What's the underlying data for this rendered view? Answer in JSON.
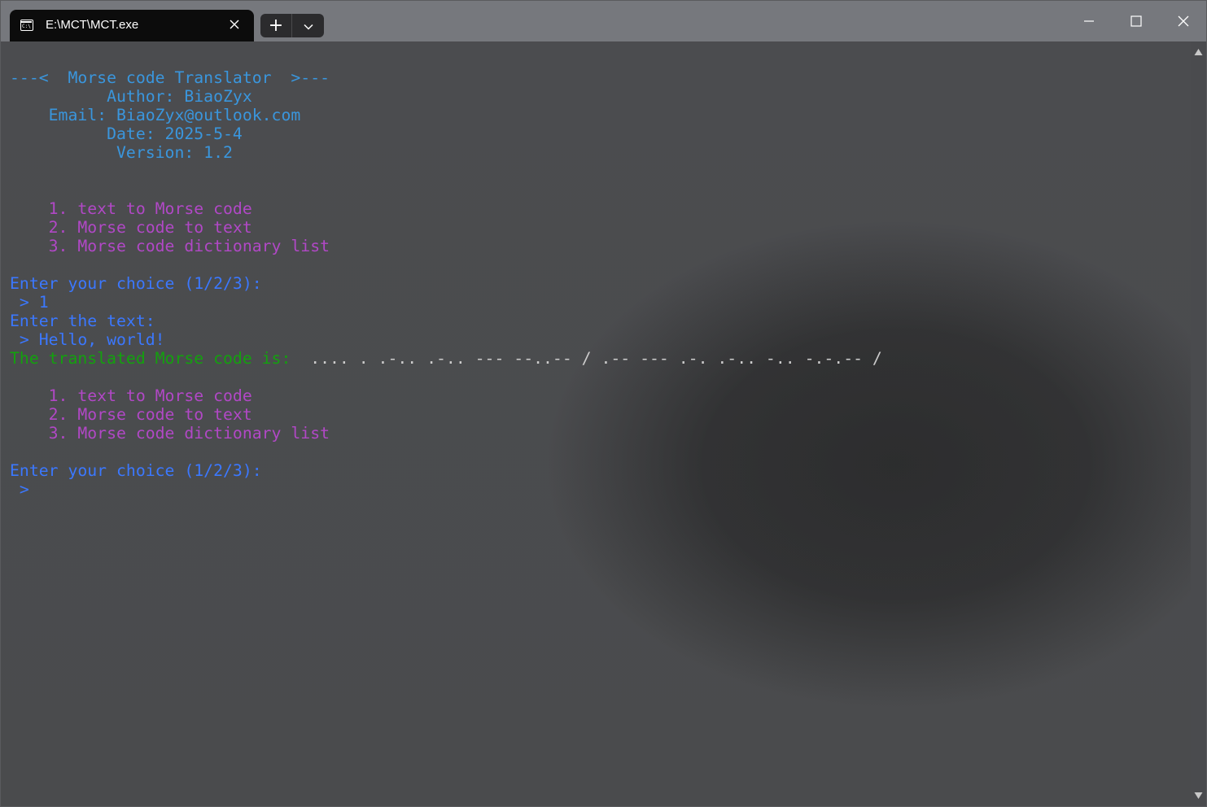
{
  "window": {
    "tab_title": "E:\\MCT\\MCT.exe",
    "tab_icon_text": "C:\\",
    "new_tab_label": "+",
    "colors": {
      "titlebar": "#76787d",
      "tab": "#0c0c0c",
      "terminal_background": "#4a4b4d"
    }
  },
  "terminal": {
    "header": {
      "title": "---<  Morse code Translator  >---",
      "author": "          Author: BiaoZyx",
      "email": "    Email: BiaoZyx@outlook.com",
      "date": "          Date: 2025-5-4",
      "version": "           Version: 1.2"
    },
    "menu1": {
      "item1": "    1. text to Morse code",
      "item2": "    2. Morse code to text",
      "item3": "    3. Morse code dictionary list"
    },
    "prompt1": "Enter your choice (1/2/3):",
    "input1": " > 1",
    "text_prompt": "Enter the text:",
    "text_input": " > Hello, world!",
    "result_label": "The translated Morse code is:",
    "result_value": "  .... . .-.. .-.. --- --..-- / .-- --- .-. .-.. -.. -.-.-- /",
    "menu2": {
      "item1": "    1. text to Morse code",
      "item2": "    2. Morse code to text",
      "item3": "    3. Morse code dictionary list"
    },
    "prompt2": "Enter your choice (1/2/3):",
    "input2": " >",
    "colors": {
      "header": "#3a96dd",
      "prompt": "#3b78ff",
      "menu": "#b148c6",
      "result_label": "#13a10e",
      "result_value": "#cccccc"
    }
  }
}
